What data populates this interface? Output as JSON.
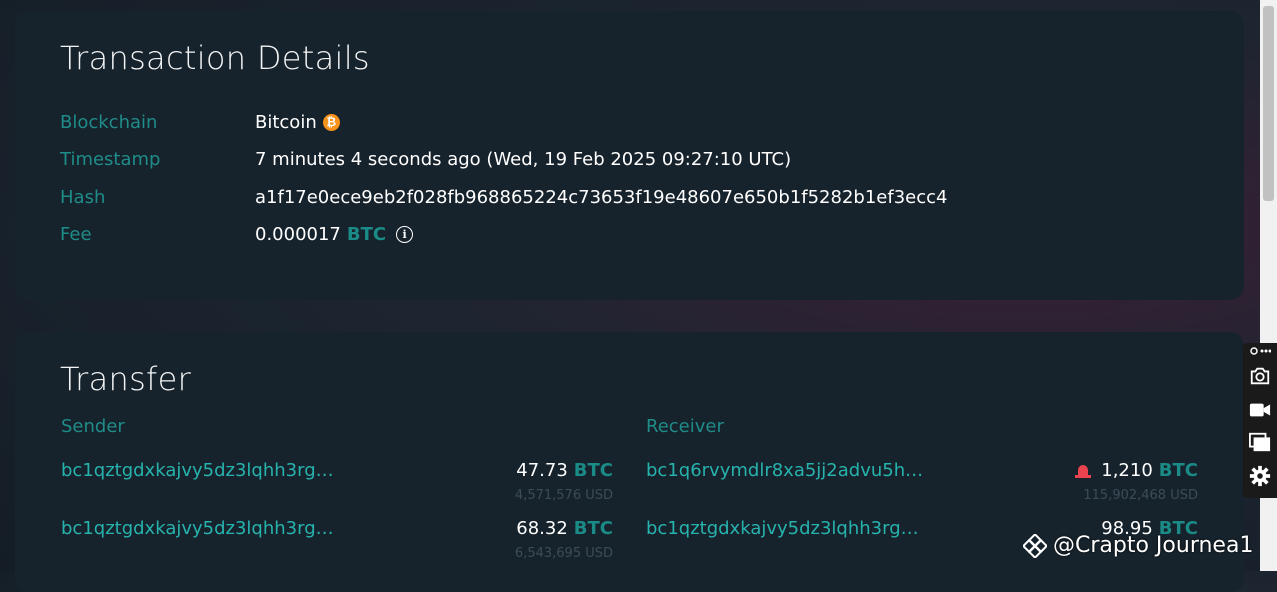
{
  "details": {
    "title": "Transaction Details",
    "rows": [
      {
        "label": "Blockchain",
        "value": "Bitcoin"
      },
      {
        "label": "Timestamp",
        "value": "7 minutes 4 seconds ago (Wed, 19 Feb 2025 09:27:10 UTC)"
      },
      {
        "label": "Hash",
        "value": "a1f17e0ece9eb2f028fb968865224c73653f19e48607e650b1f5282b1ef3ecc4"
      },
      {
        "label": "Fee",
        "value": "0.000017",
        "unit": "BTC"
      }
    ]
  },
  "transfer": {
    "title": "Transfer",
    "sender_label": "Sender",
    "receiver_label": "Receiver",
    "senders": [
      {
        "address": "bc1qztgdxkajvy5dz3lqhh3rg…",
        "amount": "47.73",
        "unit": "BTC",
        "usd": "4,571,576 USD"
      },
      {
        "address": "bc1qztgdxkajvy5dz3lqhh3rg…",
        "amount": "68.32",
        "unit": "BTC",
        "usd": "6,543,695 USD"
      }
    ],
    "receivers": [
      {
        "address": "bc1q6rvymdlr8xa5jj2advu5h…",
        "amount": "1,210",
        "unit": "BTC",
        "usd": "115,902,468 USD",
        "icon": "alert-siren-icon"
      },
      {
        "address": "bc1qztgdxkajvy5dz3lqhh3rg…",
        "amount": "98.95",
        "unit": "BTC",
        "usd": ""
      }
    ]
  },
  "watermark": {
    "text": "@Crapto Journea1"
  },
  "colors": {
    "accent": "#27b3ad",
    "label": "#1f8c89",
    "card": "#17232c",
    "bitcoin": "#f7931a",
    "alert": "#e8434e"
  }
}
